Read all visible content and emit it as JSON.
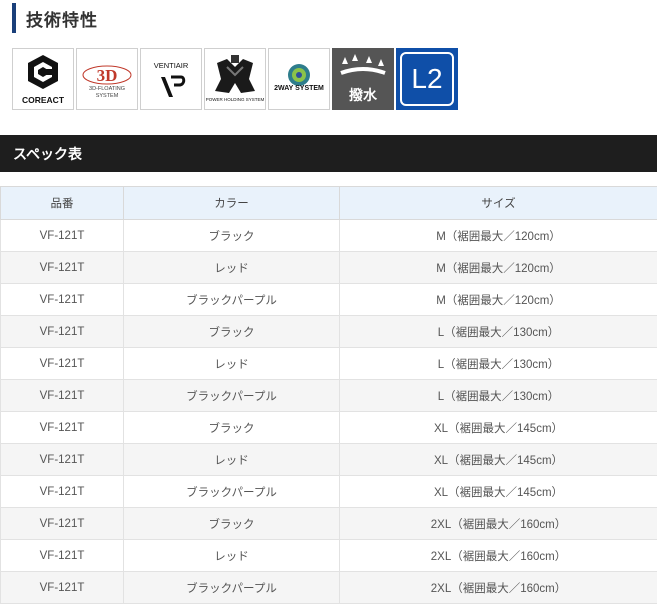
{
  "section_title": "技術特性",
  "badges": [
    {
      "icon": "coreact-logo-icon",
      "label": "COREACT"
    },
    {
      "icon": "3d-floating-system-icon",
      "label": "3D-FLOATING SYSTEM"
    },
    {
      "icon": "ventiair-logo-icon",
      "label": "VENTIAIR"
    },
    {
      "icon": "power-holding-system-icon",
      "label": "POWER HOLDING SYSTEM"
    },
    {
      "icon": "2way-system-icon",
      "label": "2WAY SYSTEM"
    },
    {
      "icon": "water-repellent-icon",
      "label": "撥水"
    },
    {
      "icon": "l2-badge-icon",
      "label": "L2"
    }
  ],
  "spec_title": "スペック表",
  "table": {
    "headers": [
      "品番",
      "カラー",
      "サイズ"
    ],
    "rows": [
      [
        "VF-121T",
        "ブラック",
        "M（裾囲最大／120cm）"
      ],
      [
        "VF-121T",
        "レッド",
        "M（裾囲最大／120cm）"
      ],
      [
        "VF-121T",
        "ブラックパープル",
        "M（裾囲最大／120cm）"
      ],
      [
        "VF-121T",
        "ブラック",
        "L（裾囲最大／130cm）"
      ],
      [
        "VF-121T",
        "レッド",
        "L（裾囲最大／130cm）"
      ],
      [
        "VF-121T",
        "ブラックパープル",
        "L（裾囲最大／130cm）"
      ],
      [
        "VF-121T",
        "ブラック",
        "XL（裾囲最大／145cm）"
      ],
      [
        "VF-121T",
        "レッド",
        "XL（裾囲最大／145cm）"
      ],
      [
        "VF-121T",
        "ブラックパープル",
        "XL（裾囲最大／145cm）"
      ],
      [
        "VF-121T",
        "ブラック",
        "2XL（裾囲最大／160cm）"
      ],
      [
        "VF-121T",
        "レッド",
        "2XL（裾囲最大／160cm）"
      ],
      [
        "VF-121T",
        "ブラックパープル",
        "2XL（裾囲最大／160cm）"
      ]
    ]
  },
  "colors": {
    "heading_bar": "#1a3f7a",
    "spec_header_bg": "#1e1e1e",
    "table_header_bg": "#e9f2fb",
    "badge_blue": "#0f4fa8",
    "badge_dark": "#555555"
  }
}
